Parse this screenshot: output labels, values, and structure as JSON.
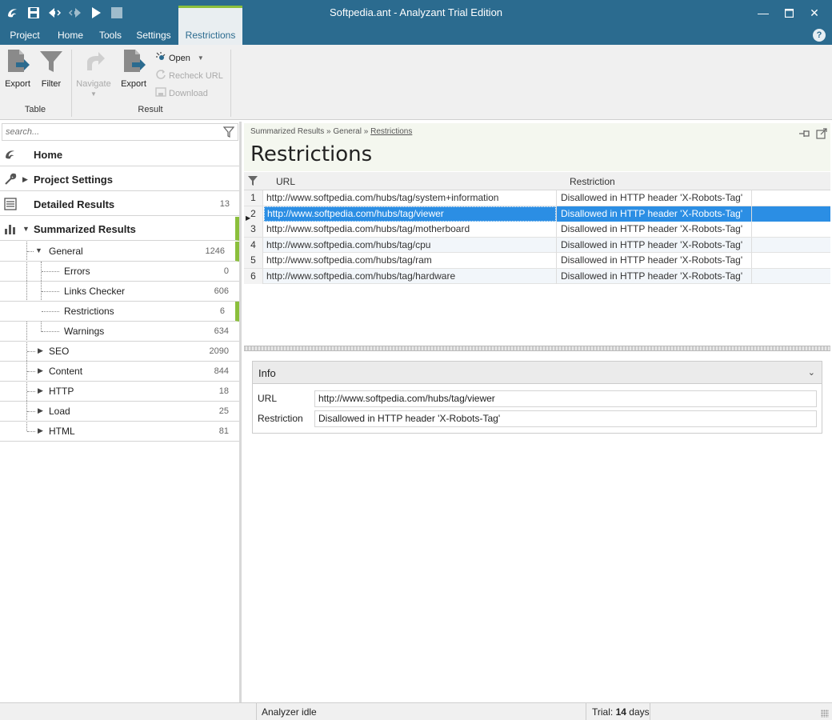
{
  "app": {
    "title": "Softpedia.ant - Analyzant Trial Edition",
    "accent_color": "#2b6b8f",
    "highlight_color": "#8bbf3c",
    "selection_color": "#2b8ee4"
  },
  "menu": {
    "tabs": [
      "Project",
      "Home",
      "Tools",
      "Settings",
      "Restrictions"
    ],
    "active": "Restrictions"
  },
  "ribbon": {
    "table_group": {
      "label": "Table",
      "export": "Export",
      "filter": "Filter"
    },
    "result_group": {
      "label": "Result",
      "navigate": "Navigate",
      "export": "Export",
      "open": "Open",
      "recheck": "Recheck URL",
      "download": "Download"
    }
  },
  "sidebar": {
    "search_placeholder": "search...",
    "items": [
      {
        "label": "Home",
        "icon": "app-logo-icon",
        "count": ""
      },
      {
        "label": "Project Settings",
        "icon": "wrench-icon",
        "count": ""
      },
      {
        "label": "Detailed Results",
        "icon": "list-icon",
        "count": "13"
      },
      {
        "label": "Summarized Results",
        "icon": "bar-chart-icon",
        "count": ""
      }
    ],
    "tree": [
      {
        "label": "General",
        "count": "1246"
      },
      {
        "label": "Errors",
        "count": "0"
      },
      {
        "label": "Links Checker",
        "count": "606"
      },
      {
        "label": "Restrictions",
        "count": "6"
      },
      {
        "label": "Warnings",
        "count": "634"
      },
      {
        "label": "SEO",
        "count": "2090"
      },
      {
        "label": "Content",
        "count": "844"
      },
      {
        "label": "HTTP",
        "count": "18"
      },
      {
        "label": "Load",
        "count": "25"
      },
      {
        "label": "HTML",
        "count": "81"
      }
    ]
  },
  "main": {
    "breadcrumb": [
      "Summarized Results",
      "General",
      "Restrictions"
    ],
    "breadcrumb_sep": "»",
    "heading": "Restrictions",
    "columns": [
      "URL",
      "Restriction"
    ],
    "rows": [
      {
        "n": "1",
        "url": "http://www.softpedia.com/hubs/tag/system+information",
        "restriction": "Disallowed in HTTP header 'X-Robots-Tag'"
      },
      {
        "n": "2",
        "url": "http://www.softpedia.com/hubs/tag/viewer",
        "restriction": "Disallowed in HTTP header 'X-Robots-Tag'"
      },
      {
        "n": "3",
        "url": "http://www.softpedia.com/hubs/tag/motherboard",
        "restriction": "Disallowed in HTTP header 'X-Robots-Tag'"
      },
      {
        "n": "4",
        "url": "http://www.softpedia.com/hubs/tag/cpu",
        "restriction": "Disallowed in HTTP header 'X-Robots-Tag'"
      },
      {
        "n": "5",
        "url": "http://www.softpedia.com/hubs/tag/ram",
        "restriction": "Disallowed in HTTP header 'X-Robots-Tag'"
      },
      {
        "n": "6",
        "url": "http://www.softpedia.com/hubs/tag/hardware",
        "restriction": "Disallowed in HTTP header 'X-Robots-Tag'"
      }
    ],
    "selected_row": "2"
  },
  "info": {
    "title": "Info",
    "url_label": "URL",
    "url_value": "http://www.softpedia.com/hubs/tag/viewer",
    "restriction_label": "Restriction",
    "restriction_value": "Disallowed in HTTP header 'X-Robots-Tag'"
  },
  "status": {
    "state": "Analyzer idle",
    "trial_label": "Trial:",
    "trial_value": "14",
    "trial_unit": "days"
  }
}
